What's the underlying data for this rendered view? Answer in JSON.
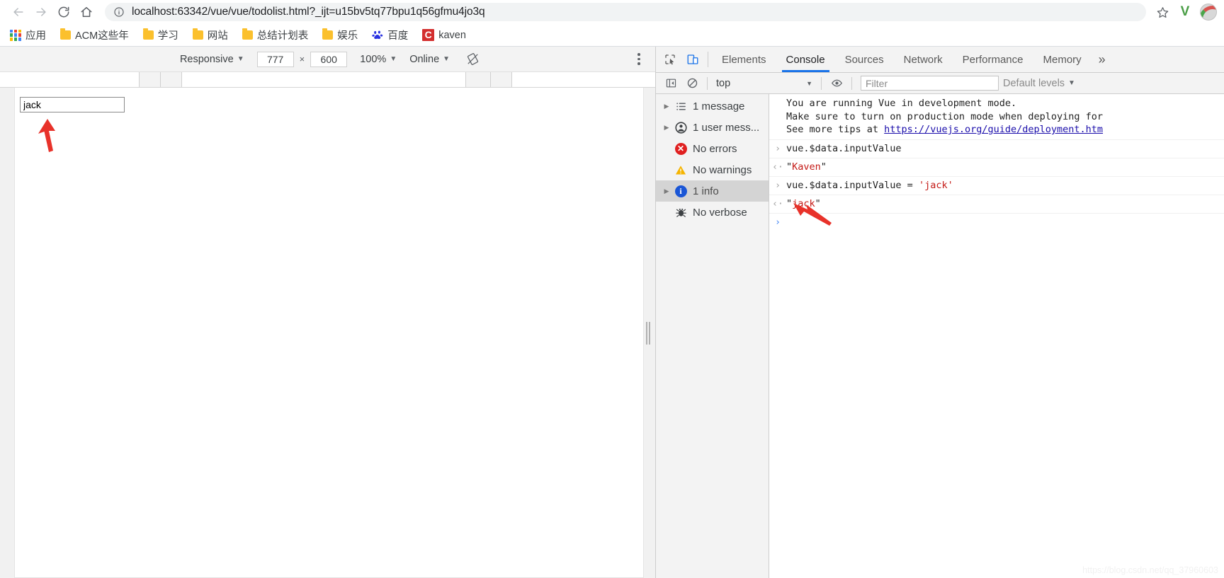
{
  "browser": {
    "nav": {
      "back_icon": "arrow-left-icon",
      "forward_icon": "arrow-right-icon",
      "reload_icon": "reload-icon",
      "home_icon": "home-icon"
    },
    "omnibox": {
      "security_icon": "info-circle-icon",
      "url": "localhost:63342/vue/vue/todolist.html?_ijt=u15bv5tq77bpu1q56gfmu4jo3q",
      "bookmark_star_icon": "star-icon",
      "extension_badge": "V",
      "profile_icon": "avatar-icon"
    },
    "bookmarks": [
      {
        "icon": "apps-grid-icon",
        "label": "应用"
      },
      {
        "icon": "folder-icon",
        "label": "ACM这些年"
      },
      {
        "icon": "folder-icon",
        "label": "学习"
      },
      {
        "icon": "folder-icon",
        "label": "网站"
      },
      {
        "icon": "folder-icon",
        "label": "总结计划表"
      },
      {
        "icon": "folder-icon",
        "label": "娱乐"
      },
      {
        "icon": "baidu-icon",
        "label": "百度"
      },
      {
        "icon": "csdn-c-icon",
        "label": "kaven"
      }
    ]
  },
  "device_toolbar": {
    "device": "Responsive",
    "width": "777",
    "height": "600",
    "x_symbol": "×",
    "zoom": "100%",
    "throttling": "Online",
    "rotate_icon": "rotate-device-icon",
    "menu_icon": "more-vertical-icon"
  },
  "page": {
    "input_value": "jack",
    "input_placeholder": "",
    "annotation_arrow": "red-arrow-up"
  },
  "devtools": {
    "toolbar_icons": {
      "inspect": "inspect-element-icon",
      "device_toggle": "device-toolbar-icon"
    },
    "tabs": [
      {
        "label": "Elements",
        "selected": false
      },
      {
        "label": "Console",
        "selected": true
      },
      {
        "label": "Sources",
        "selected": false
      },
      {
        "label": "Network",
        "selected": false
      },
      {
        "label": "Performance",
        "selected": false
      },
      {
        "label": "Memory",
        "selected": false
      }
    ],
    "more_tabs_icon": "chevron-double-right-icon",
    "console_toolbar": {
      "sidebar_toggle_icon": "show-console-sidebar-icon",
      "clear_icon": "clear-console-icon",
      "context": "top",
      "eye_icon": "live-expression-icon",
      "filter_placeholder": "Filter",
      "filter_value": "",
      "levels": "Default levels"
    },
    "sidebar": [
      {
        "icon": "list-icon",
        "label": "1 message",
        "expandable": true,
        "selected": false
      },
      {
        "icon": "user-icon",
        "label": "1 user mess...",
        "expandable": true,
        "selected": false
      },
      {
        "icon": "error-icon",
        "label": "No errors",
        "expandable": false,
        "selected": false
      },
      {
        "icon": "warning-icon",
        "label": "No warnings",
        "expandable": false,
        "selected": false
      },
      {
        "icon": "info-icon",
        "label": "1 info",
        "expandable": true,
        "selected": true
      },
      {
        "icon": "bug-icon",
        "label": "No verbose",
        "expandable": false,
        "selected": false
      }
    ],
    "log": {
      "info_message": [
        "You are running Vue in development mode.",
        "Make sure to turn on production mode when deploying for",
        "See more tips at "
      ],
      "info_link": "https://vuejs.org/guide/deployment.htm",
      "entries": [
        {
          "gutter": "›",
          "type": "input",
          "text": "vue.$data.inputValue"
        },
        {
          "gutter": "‹·",
          "type": "output",
          "quote": "\"",
          "value": "Kaven"
        },
        {
          "gutter": "›",
          "type": "input_assign",
          "prefix": "vue.$data.inputValue = ",
          "assigned": "'jack'"
        },
        {
          "gutter": "‹·",
          "type": "output",
          "quote": "\"",
          "value": "jack"
        },
        {
          "gutter": "›",
          "type": "prompt",
          "text": ""
        }
      ],
      "annotation_arrow": "red-arrow-up-left"
    }
  },
  "watermark": "https://blog.csdn.net/qq_37960603",
  "colors": {
    "accent_blue": "#1a73e8",
    "error_red": "#d93025",
    "warning_yellow": "#f5b400",
    "info_blue": "#1a56d6",
    "string_red": "#c41a16",
    "link_blue": "#1a0dab",
    "arrow_red": "#e8322a"
  }
}
